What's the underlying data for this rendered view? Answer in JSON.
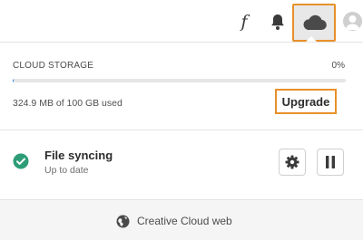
{
  "header": {
    "font_icon_glyph": "f",
    "icons": [
      "font-icon",
      "bell-icon",
      "cloud-icon",
      "avatar"
    ]
  },
  "storage": {
    "title": "CLOUD STORAGE",
    "percent_label": "0%",
    "used_fraction": 0.003,
    "used_text": "324.9 MB of 100 GB used",
    "upgrade_label": "Upgrade"
  },
  "sync": {
    "title": "File syncing",
    "status": "Up to date",
    "icons": [
      "check-circle-icon",
      "gear-icon",
      "pause-icon"
    ]
  },
  "footer": {
    "web_label": "Creative Cloud web",
    "icon": "globe-icon"
  },
  "colors": {
    "accent": "#e8902a",
    "success": "#2d9d78",
    "progress": "#2680eb"
  }
}
